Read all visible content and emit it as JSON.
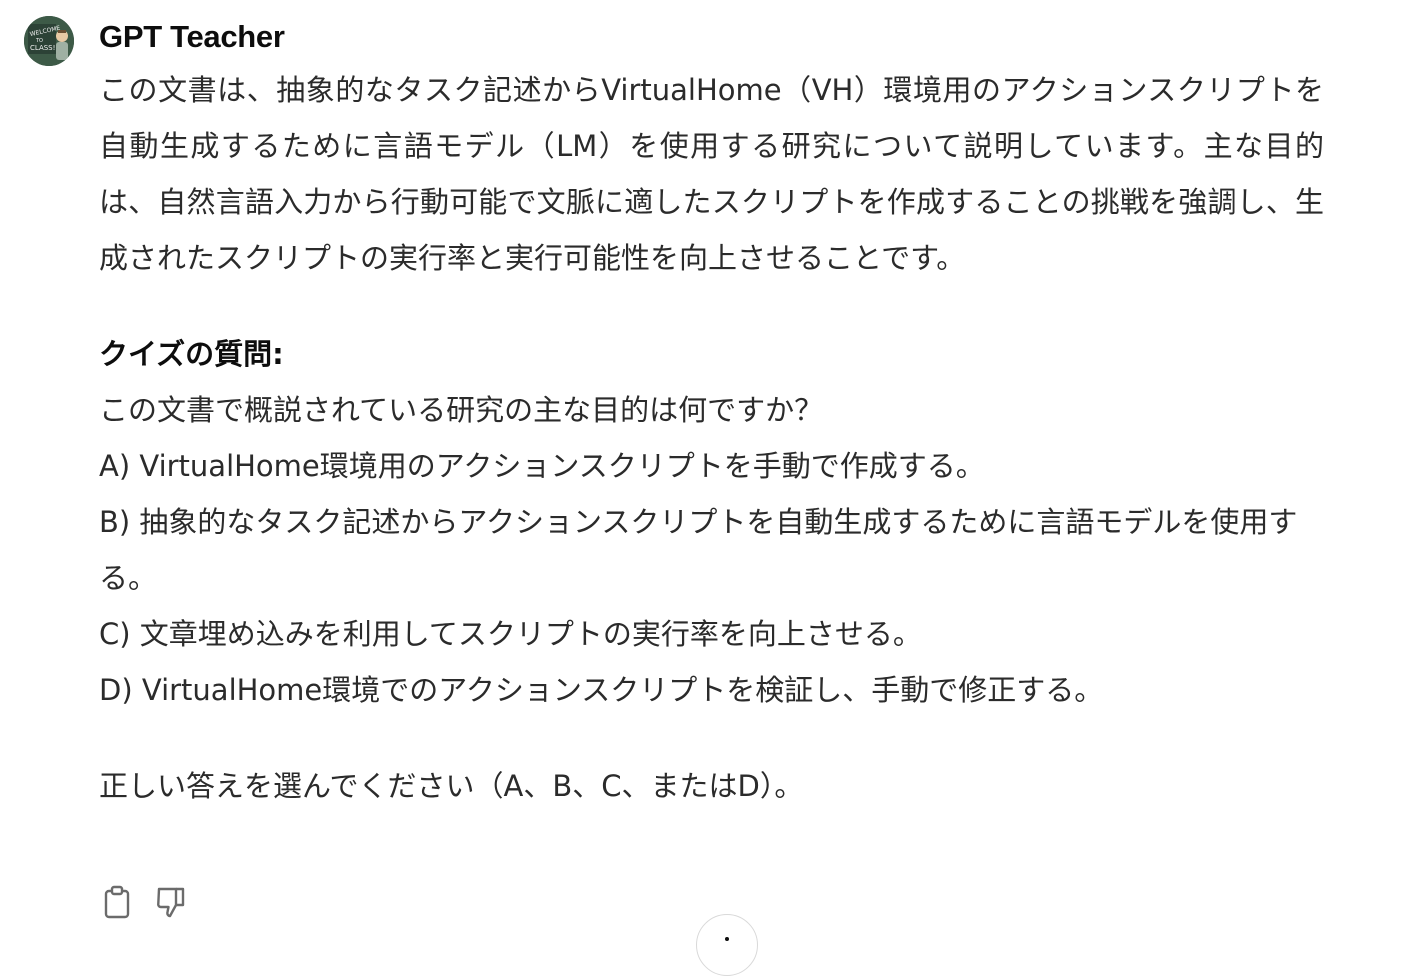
{
  "message": {
    "sender": "GPT Teacher",
    "avatar_icon": "teacher-chalkboard-avatar",
    "summary": "この文書は、抽象的なタスク記述からVirtualHome（VH）環境用のアクションスクリプトを自動生成するために言語モデル（LM）を使用する研究について説明しています。主な目的は、自然言語入力から行動可能で文脈に適したスクリプトを作成することの挑戦を強調し、生成されたスクリプトの実行率と実行可能性を向上させることです。",
    "quiz": {
      "heading": "クイズの質問:",
      "question": "この文書で概説されている研究の主な目的は何ですか？",
      "options": [
        "A) VirtualHome環境用のアクションスクリプトを手動で作成する。",
        "B) 抽象的なタスク記述からアクションスクリプトを自動生成するために言語モデルを使用する。",
        "C) 文章埋め込みを利用してスクリプトの実行率を向上させる。",
        "D) VirtualHome環境でのアクションスクリプトを検証し、手動で修正する。"
      ],
      "instruction": "正しい答えを選んでください（A、B、C、またはD）。"
    }
  },
  "actions": {
    "copy_icon": "clipboard-icon",
    "dislike_icon": "thumbs-down-icon"
  },
  "colors": {
    "text": "#2b2b2b",
    "heading": "#0d0d0d",
    "icon": "#6b6b6b"
  }
}
